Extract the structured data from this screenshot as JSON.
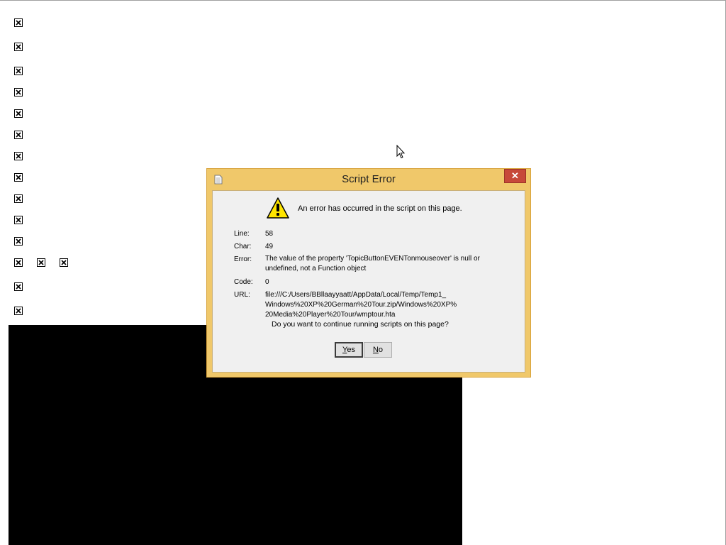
{
  "dialog": {
    "title": "Script Error",
    "close_label": "✕",
    "headline": "An error has occurred in the script on this page.",
    "line_label": "Line:",
    "line_value": "58",
    "char_label": "Char:",
    "char_value": "49",
    "error_label": "Error:",
    "error_value_1": "The value of the property 'TopicButtonEVENTonmouseover' is null or",
    "error_value_2": "undefined, not a Function object",
    "code_label": "Code:",
    "code_value": "0",
    "url_label": "URL:",
    "url_value_1": "file:///C:/Users/BBllaayyaatt/AppData/Local/Temp/Temp1_",
    "url_value_2": "Windows%20XP%20German%20Tour.zip/Windows%20XP%",
    "url_value_3": "20Media%20Player%20Tour/wmptour.hta",
    "question": "Do you want to continue running scripts on this page?",
    "yes_first": "Y",
    "yes_rest": "es",
    "no_first": "N",
    "no_rest": "o"
  },
  "icons": {
    "broken_image": "broken-image-icon",
    "warning": "warning-icon",
    "document": "document-icon",
    "cursor": "mouse-cursor-icon"
  },
  "colors": {
    "titlebar": "#f0c86a",
    "close_button": "#c7493a",
    "client": "#f0f0f0"
  }
}
